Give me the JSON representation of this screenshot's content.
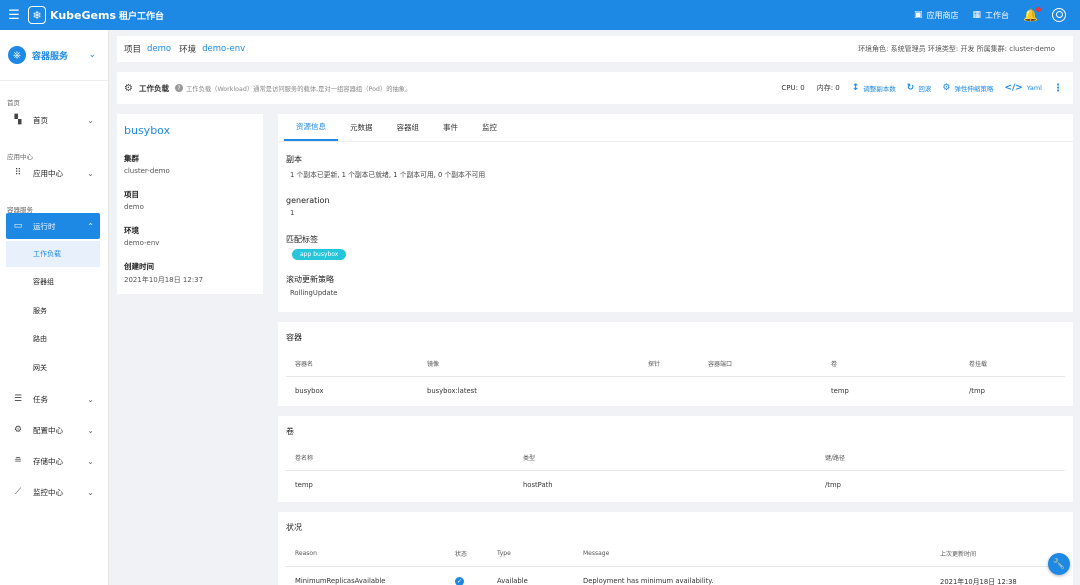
{
  "topbar": {
    "brand": "KubeGems",
    "brand_sub": "租户工作台",
    "app_store": "应用商店",
    "workbench": "工作台"
  },
  "sidebar": {
    "header": "容器服务",
    "sections": {
      "home": "首页",
      "app_center": "应用中心",
      "container_service": "容器服务"
    },
    "items": {
      "home": "首页",
      "app_center": "应用中心",
      "runtime": "运行时",
      "workload": "工作负载",
      "pod": "容器组",
      "service": "服务",
      "route": "路由",
      "gateway": "网关",
      "task": "任务",
      "config": "配置中心",
      "storage": "存储中心",
      "monitor": "监控中心"
    }
  },
  "breadcrumb": {
    "project_label": "项目",
    "project": "demo",
    "env_label": "环境",
    "env": "demo-env",
    "right": "环境角色: 系统管理员   环境类型: 开发   所属集群: cluster-demo"
  },
  "workload": {
    "title": "工作负载",
    "desc": "工作负载（Workload）通常是访问服务的载体,是对一组容器组（Pod）的抽象。",
    "cpu": "CPU: 0",
    "mem": "内存: 0",
    "actions": {
      "scale": "调整副本数",
      "rollback": "回滚",
      "hpa": "弹性伸缩策略",
      "yaml": "Yaml"
    }
  },
  "info": {
    "name": "busybox",
    "cluster_label": "集群",
    "cluster": "cluster-demo",
    "project_label": "项目",
    "project": "demo",
    "env_label": "环境",
    "env": "demo-env",
    "created_label": "创建时间",
    "created": "2021年10月18日 12:37"
  },
  "tabs": [
    "资源信息",
    "元数据",
    "容器组",
    "事件",
    "监控"
  ],
  "resource": {
    "replicas_label": "副本",
    "replicas": "1 个副本已更新, 1 个副本已就绪, 1 个副本可用, 0 个副本不可用",
    "generation_label": "generation",
    "generation": "1",
    "labels_label": "匹配标签",
    "label_chip": "app busybox",
    "strategy_label": "滚动更新策略",
    "strategy": "RollingUpdate"
  },
  "containers": {
    "title": "容器",
    "headers": [
      "容器名",
      "镜像",
      "探针",
      "容器端口",
      "卷",
      "卷挂载"
    ],
    "rows": [
      [
        "busybox",
        "busybox:latest",
        "",
        "",
        "temp",
        "/tmp"
      ]
    ]
  },
  "volumes": {
    "title": "卷",
    "headers": [
      "卷名称",
      "类型",
      "键/路径"
    ],
    "rows": [
      [
        "temp",
        "hostPath",
        "/tmp"
      ]
    ]
  },
  "conditions": {
    "title": "状况",
    "headers": [
      "Reason",
      "状态",
      "Type",
      "Message",
      "上次更新时间"
    ],
    "rows": [
      [
        "MinimumReplicasAvailable",
        "",
        "Available",
        "Deployment has minimum availability.",
        "2021年10月18日 12:38"
      ]
    ]
  }
}
